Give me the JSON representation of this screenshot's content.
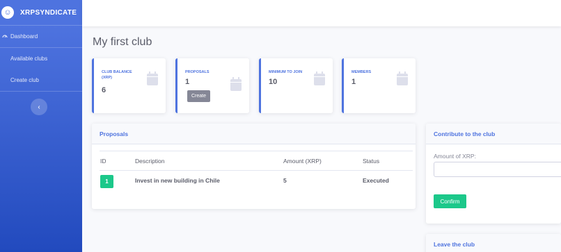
{
  "sidebar": {
    "brand": "XRPSYNDICATE",
    "logo_glyph": "☺",
    "items": [
      {
        "label": "Dashboard",
        "icon": "dashboard-icon"
      },
      {
        "label": "Available clubs"
      },
      {
        "label": "Create club"
      }
    ],
    "toggle_glyph": "‹"
  },
  "page": {
    "title": "My first club"
  },
  "stats": [
    {
      "label": "CLUB BALANCE (XRP)",
      "value": "6"
    },
    {
      "label": "PROPOSALS",
      "value": "1",
      "button": "Create"
    },
    {
      "label": "MINIMUM TO JOIN",
      "value": "10"
    },
    {
      "label": "MEMBERS",
      "value": "1"
    }
  ],
  "proposals": {
    "title": "Proposals",
    "columns": [
      "ID",
      "Description",
      "Amount (XRP)",
      "Status"
    ],
    "rows": [
      {
        "id": "1",
        "description": "Invest in new building in Chile",
        "amount": "5",
        "status": "Executed"
      }
    ]
  },
  "contribute": {
    "title": "Contribute to the club",
    "field_label": "Amount of XRP:",
    "field_value": "",
    "button": "Confirm"
  },
  "leave": {
    "title": "Leave the club"
  },
  "colors": {
    "primary": "#4e73df",
    "success": "#1cc88a",
    "secondary": "#858796"
  }
}
